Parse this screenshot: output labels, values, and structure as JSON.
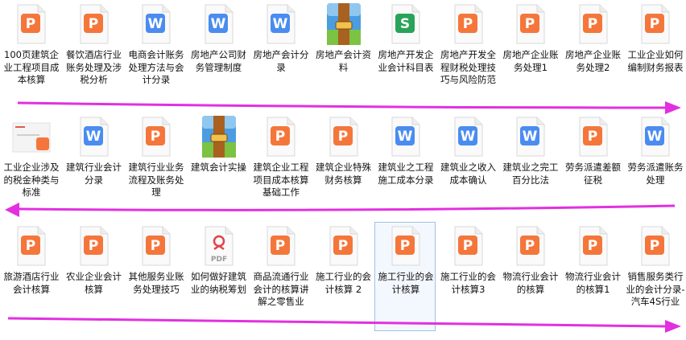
{
  "files": [
    {
      "type": "ppt",
      "label": "100页建筑企业工程项目成本核算"
    },
    {
      "type": "ppt",
      "label": "餐饮酒店行业账务处理及涉税分析"
    },
    {
      "type": "word",
      "label": "电商会计账务处理方法与会计分录"
    },
    {
      "type": "word",
      "label": "房地产公司财务管理制度"
    },
    {
      "type": "word",
      "label": "房地产会计分录"
    },
    {
      "type": "zip",
      "label": "房地产会计资料"
    },
    {
      "type": "excel",
      "label": "房地产开发企业会计科目表"
    },
    {
      "type": "ppt",
      "label": "房地产开发全程财税处理技巧与风险防范"
    },
    {
      "type": "ppt",
      "label": "房地产企业账务处理1"
    },
    {
      "type": "ppt",
      "label": "房地产企业账务处理2"
    },
    {
      "type": "ppt",
      "label": "工业企业如何编制财务报表"
    },
    {
      "type": "thumb",
      "label": "工业企业涉及的税金种类与标准"
    },
    {
      "type": "word",
      "label": "建筑行业会计分录"
    },
    {
      "type": "ppt",
      "label": "建筑行业业务流程及账务处理"
    },
    {
      "type": "zip",
      "label": "建筑会计实操"
    },
    {
      "type": "ppt",
      "label": "建筑企业工程项目成本核算基础工作"
    },
    {
      "type": "ppt",
      "label": "建筑企业特殊财务核算"
    },
    {
      "type": "word",
      "label": "建筑业之工程施工成本分录"
    },
    {
      "type": "word",
      "label": "建筑业之收入成本确认"
    },
    {
      "type": "word",
      "label": "建筑业之完工百分比法"
    },
    {
      "type": "ppt",
      "label": "劳务派遣差额征税"
    },
    {
      "type": "word",
      "label": "劳务派遣账务处理"
    },
    {
      "type": "ppt",
      "label": "旅游酒店行业会计核算"
    },
    {
      "type": "ppt",
      "label": "农业企业会计核算"
    },
    {
      "type": "ppt",
      "label": "其他服务业账务处理技巧"
    },
    {
      "type": "pdf",
      "label": "如何做好建筑业的纳税筹划"
    },
    {
      "type": "ppt",
      "label": "商品流通行业会计的核算讲解之零售业"
    },
    {
      "type": "ppt",
      "label": "施工行业的会计核算 2"
    },
    {
      "type": "ppt",
      "label": "施工行业的会计核算",
      "selected": true
    },
    {
      "type": "ppt",
      "label": "施工行业的会计核算3"
    },
    {
      "type": "ppt",
      "label": "物流行业会计的核算"
    },
    {
      "type": "ppt",
      "label": "物流行业会计的核算1"
    },
    {
      "type": "ppt",
      "label": "销售服务类行业的会计分录-汽车4S行业"
    }
  ],
  "icons": {
    "ppt": {
      "color": "#f5763b",
      "glyph": "P"
    },
    "word": {
      "color": "#4a8cf0",
      "glyph": "W"
    },
    "excel": {
      "color": "#29a35a",
      "glyph": "S"
    },
    "pdf": {
      "color": "#e0454a",
      "glyph": "PDF"
    },
    "zip": {
      "color": "#4a9de0"
    },
    "thumb": {
      "color": "#e05a4a"
    }
  },
  "arrow_color": "#e230e0"
}
